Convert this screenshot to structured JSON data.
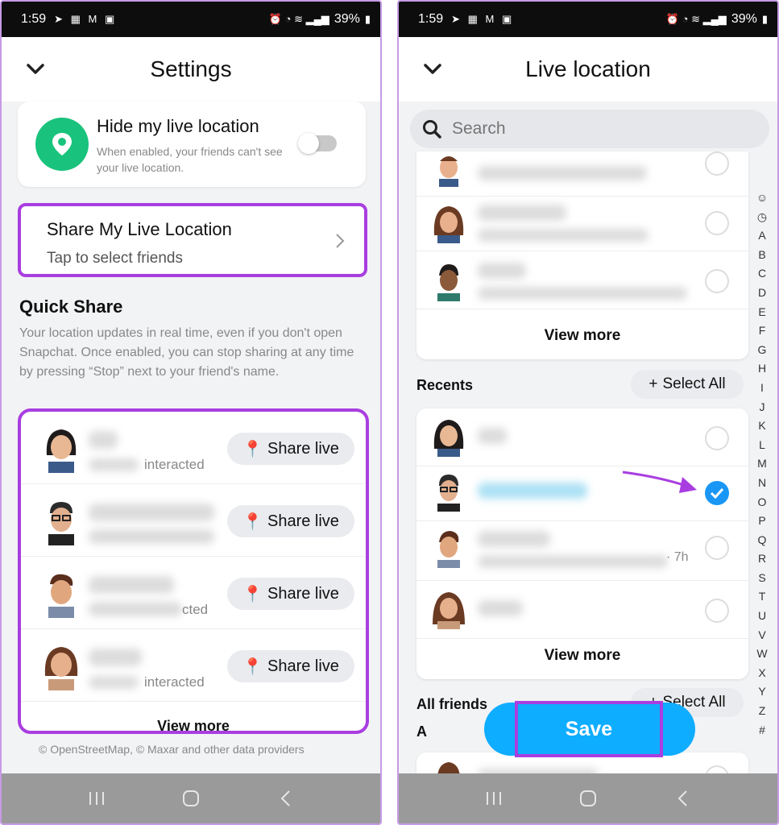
{
  "status": {
    "time": "1:59",
    "battery": "39%"
  },
  "left": {
    "title": "Settings",
    "hide_location": {
      "title": "Hide my live location",
      "description": "When enabled, your friends can't see your live location."
    },
    "share": {
      "title": "Share My Live Location",
      "subtitle": "Tap to select friends"
    },
    "quick_share": {
      "title": "Quick Share",
      "description": "Your location updates in real time, even if you don't open Snapchat. Once enabled, you can stop sharing at any time by pressing “Stop” next to your friend's name.",
      "rows": [
        {
          "meta": "interacted",
          "button": "Share live"
        },
        {
          "meta": "",
          "button": "Share live"
        },
        {
          "meta": "cted",
          "button": "Share live"
        },
        {
          "meta": "interacted",
          "button": "Share live"
        }
      ],
      "view_more": "View more"
    },
    "attribution": "© OpenStreetMap, © Maxar and other data providers"
  },
  "right": {
    "title": "Live location",
    "search_placeholder": "Search",
    "top_view_more": "View more",
    "recents_label": "Recents",
    "select_all": "Select All",
    "recents_view_more": "View more",
    "recent_hint": "· 7h",
    "all_friends_label": "All friends",
    "all_friends_select_all": "Select All",
    "section_a": "A",
    "save": "Save",
    "alphabet": [
      "☺",
      "◷",
      "A",
      "B",
      "C",
      "D",
      "E",
      "F",
      "G",
      "H",
      "I",
      "J",
      "K",
      "L",
      "M",
      "N",
      "O",
      "P",
      "Q",
      "R",
      "S",
      "T",
      "U",
      "V",
      "W",
      "X",
      "Y",
      "Z",
      "#"
    ]
  },
  "colors": {
    "accent": "#0fadff",
    "highlight": "#a93ee0",
    "toggle_icon": "#19c37d",
    "check": "#1a97f5"
  }
}
